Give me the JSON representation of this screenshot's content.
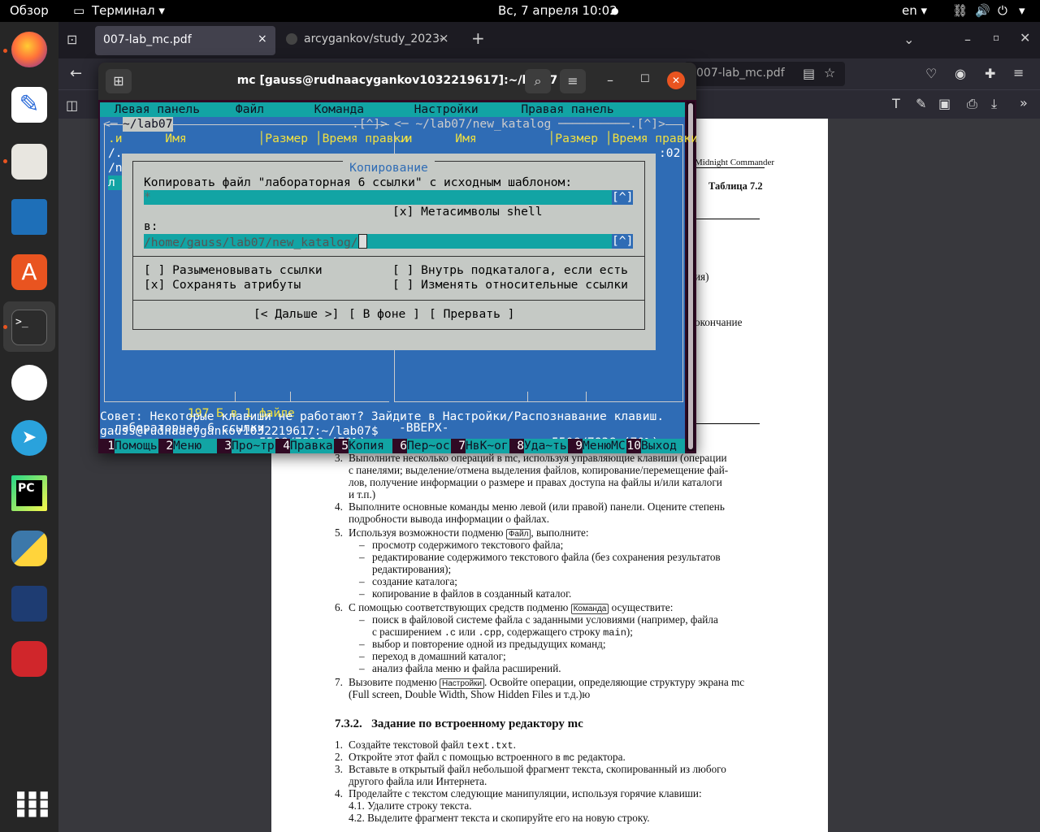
{
  "topbar": {
    "overview": "Обзор",
    "app": "Терминал",
    "datetime": "Вс, 7 апреля  10:02",
    "lang": "en"
  },
  "firefox": {
    "tab1": "007-lab_mc.pdf",
    "tab2": "arcygankov/study_2023-",
    "url": "007-lab_mc.pdf",
    "new_tab": "+",
    "close": "×"
  },
  "pdf": {
    "header_right": "Midnight Commander",
    "table_label": "Таблица 7.2",
    "frag1": "ия)",
    "frag2": "окончание",
    "items": [
      {
        "n": "3.",
        "lines": [
          "Выполните несколько операций в mc, используя управляющие клавиши (операции",
          "с панелями; выделение/отмена выделения файлов, копирование/перемещение фай-",
          "лов, получение информации о размере и правах доступа на файлы и/или каталоги",
          "и т.п.)"
        ]
      },
      {
        "n": "4.",
        "lines": [
          "Выполните основные команды меню левой (или правой) панели. Оцените степень",
          "подробности вывода информации о файлах."
        ]
      }
    ],
    "item5_pre": "Используя возможности подменю ",
    "item5_kbd": "Файл",
    "item5_post": ", выполните:",
    "item5_sub": [
      "просмотр содержимого текстового файла;",
      "редактирование содержимого текстового файла (без сохранения результатов",
      "редактирования);",
      "создание каталога;",
      "копирование в файлов в созданный каталог."
    ],
    "item6_pre": "С помощью соответствующих средств подменю ",
    "item6_kbd": "Команда",
    "item6_post": " осуществите:",
    "item6_sub1a": "поиск в файловой системе файла с заданными условиями (например, файла",
    "item6_sub1b_pre": "с расширением ",
    "item6_c": ".c",
    "item6_or": " или ",
    "item6_cpp": ".cpp",
    "item6_mid": ", содержащего строку ",
    "item6_main": "main",
    "item6_end": ");",
    "item6_sub": [
      "выбор и повторение одной из предыдущих команд;",
      "переход в домашний каталог;",
      "анализ файла меню и файла расширений."
    ],
    "item7_pre": "Вызовите подменю ",
    "item7_kbd": "Настройки",
    "item7_post": ". Освойте операции, определяющие структуру экрана mc",
    "item7_line2": "(Full screen, Double Width, Show Hidden Files и т.д.)ю",
    "section_num": "7.3.2.",
    "section_title": "Задание по встроенному редактору mc",
    "e1_pre": "Создайте текстовой файл ",
    "e1_code": "text.txt",
    "e1_post": ".",
    "e2_pre": "Откройте этот файл с помощью встроенного в ",
    "e2_code": "mc",
    "e2_post": " редактора.",
    "e3a": "Вставьте в открытый файл небольшой фрагмент текста, скопированный из любого",
    "e3b": "другого файла или Интернета.",
    "e4": "Проделайте с текстом следующие манипуляции, используя горячие клавиши:",
    "e41": "4.1.   Удалите строку текста.",
    "e42": "4.2.   Выделите фрагмент текста и скопируйте его на новую строку."
  },
  "terminal": {
    "title": "mc [gauss@rudnaacygankov1032219617]:~/lab07",
    "menubar": "  Левая панель     Файл       Команда       Настройки      Правая панель",
    "left_hdr_l": "<─ ",
    "left_path": "~/lab07",
    "left_hdr_r": ".[^]>",
    "right_hdr": "<─ ~/lab07/new_katalog ──────────.[^]>",
    "col_hdr": ".и      Имя          │Размер │Время правки",
    "row_up": "/.",
    "row_n": "/n",
    "row_l": "л",
    "right_time": ":02",
    "left_info": "197 Б в 1 файле",
    "left_file": "лабораторная 6 ссылки",
    "right_file": "-ВВЕРХ-",
    "disk": "550G/783G (70%)",
    "hint": "Совет: Некоторые клавиши не работают? Зайдите в Настройки/Распознавание клавиш.",
    "prompt": "gauss@rudnaacygankov1032219617:~/lab07$",
    "fkeys": [
      {
        "n": "1",
        "l": "Помощь"
      },
      {
        "n": "2",
        "l": "Меню"
      },
      {
        "n": "3",
        "l": "Про~тр"
      },
      {
        "n": "4",
        "l": "Правка"
      },
      {
        "n": "5",
        "l": "Копия"
      },
      {
        "n": "6",
        "l": "Пер~ос"
      },
      {
        "n": "7",
        "l": "НвК~ог"
      },
      {
        "n": "8",
        "l": "Уда~ть"
      },
      {
        "n": "9",
        "l": "МенюМС"
      },
      {
        "n": "10",
        "l": "Выход"
      }
    ]
  },
  "dialog": {
    "title": "Копирование",
    "prompt": "Копировать файл \"лабораторная 6 ссылки\" с исходным шаблоном:",
    "source": "*",
    "hist": "[^]",
    "meta": "[x] Метасимволы shell",
    "to_label": "в:",
    "dest": "/home/gauss/lab07/new_katalog/",
    "opt1": "[ ] Разыменовывать ссылки",
    "opt2": "[x] Сохранять атрибуты",
    "opt3": "[ ] Внутрь подкаталога, если есть",
    "opt4": "[ ] Изменять относительные ссылки",
    "btn_ok": "[< Дальше >]",
    "btn_bg": "[ В фоне ]",
    "btn_cancel": "[ Прервать ]"
  }
}
